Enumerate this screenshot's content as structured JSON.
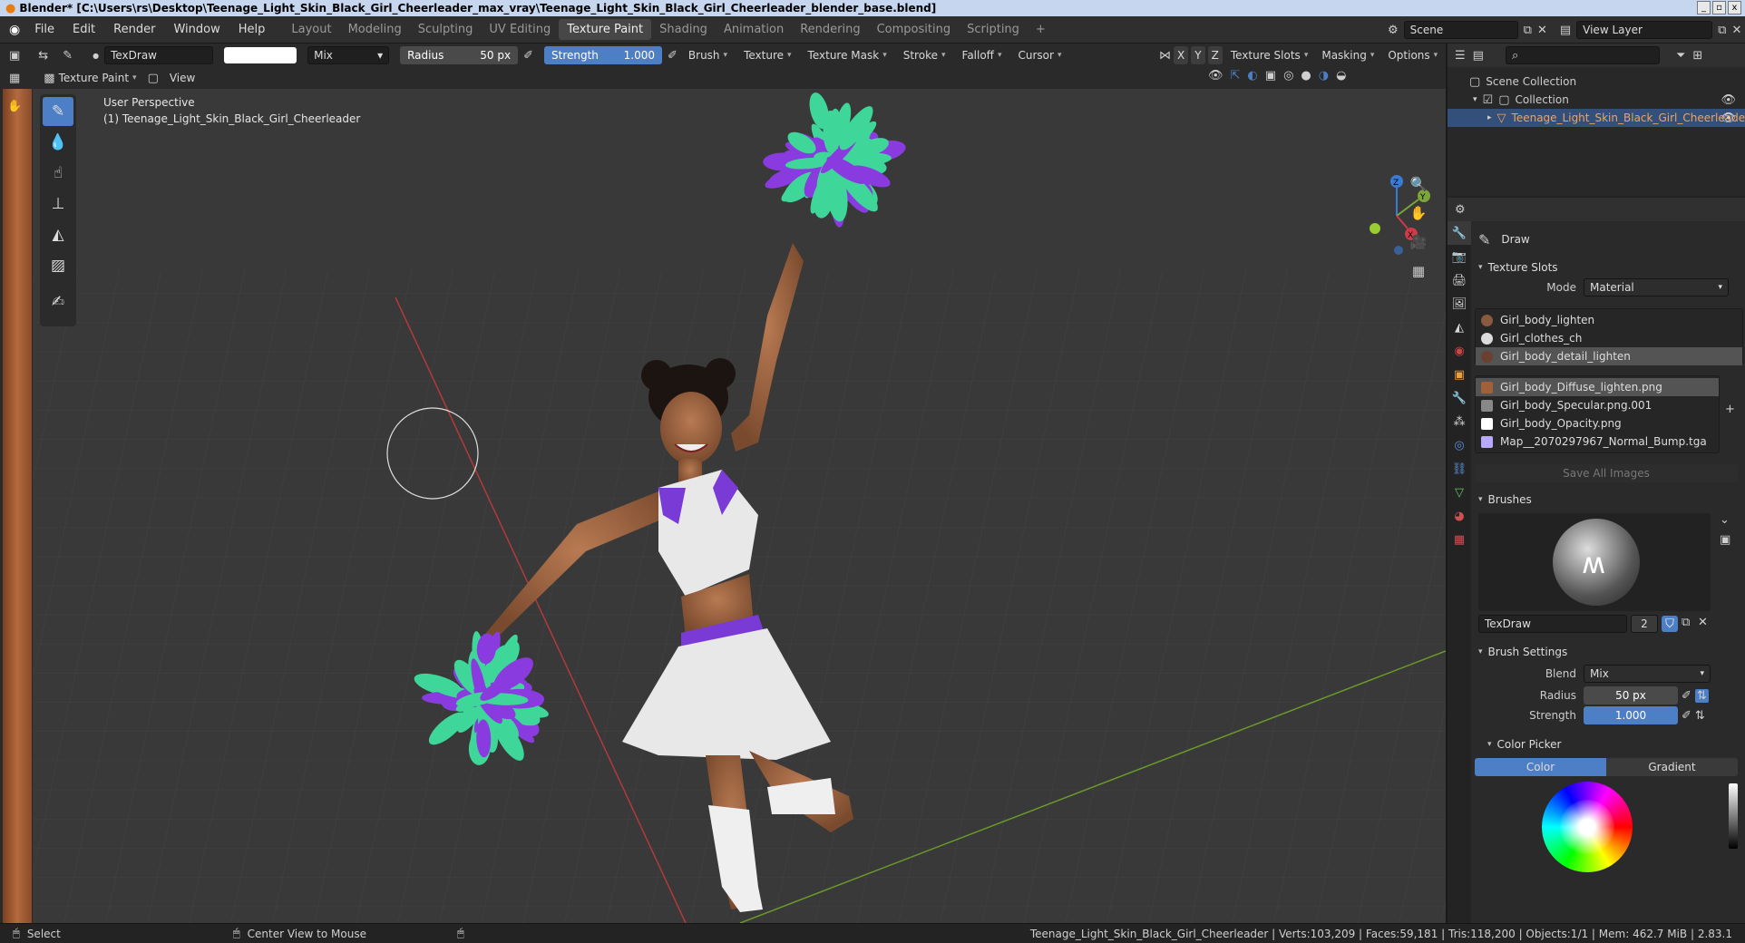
{
  "title_bar": {
    "text": "Blender* [C:\\Users\\rs\\Desktop\\Teenage_Light_Skin_Black_Girl_Cheerleader_max_vray\\Teenage_Light_Skin_Black_Girl_Cheerleader_blender_base.blend]",
    "min": "_",
    "max": "▫",
    "close": "x"
  },
  "menu": {
    "items": [
      "File",
      "Edit",
      "Render",
      "Window",
      "Help"
    ]
  },
  "workspaces": {
    "tabs": [
      "Layout",
      "Modeling",
      "Sculpting",
      "UV Editing",
      "Texture Paint",
      "Shading",
      "Animation",
      "Rendering",
      "Compositing",
      "Scripting"
    ],
    "active": "Texture Paint",
    "add": "+"
  },
  "scene": {
    "name": "Scene",
    "view_layer": "View Layer"
  },
  "tool_header": {
    "brush_name": "TexDraw",
    "blend": "Mix",
    "radius_label": "Radius",
    "radius_value": "50 px",
    "strength_label": "Strength",
    "strength_value": "1.000",
    "menus": [
      "Brush",
      "Texture",
      "Texture Mask",
      "Stroke",
      "Falloff",
      "Cursor"
    ],
    "axes": [
      "X",
      "Y",
      "Z"
    ],
    "right_menus": [
      "Texture Slots",
      "Masking",
      "Options"
    ]
  },
  "mode_header": {
    "mode": "Texture Paint",
    "view": "View"
  },
  "viewport": {
    "perspective": "User Perspective",
    "object": "(1) Teenage_Light_Skin_Black_Girl_Cheerleader",
    "gizmo": {
      "x": "X",
      "y": "Y",
      "z": "Z"
    }
  },
  "outliner": {
    "root": "Scene Collection",
    "collection": "Collection",
    "object": "Teenage_Light_Skin_Black_Girl_Cheerleader"
  },
  "properties": {
    "tool_name": "Draw",
    "texture_slots_header": "Texture Slots",
    "mode_label": "Mode",
    "mode_value": "Material",
    "materials": [
      "Girl_body_lighten",
      "Girl_clothes_ch",
      "Girl_body_detail_lighten"
    ],
    "selected_material": 2,
    "images": [
      "Girl_body_Diffuse_lighten.png",
      "Girl_body_Specular.png.001",
      "Girl_body_Opacity.png",
      "Map__2070297967_Normal_Bump.tga"
    ],
    "selected_image": 0,
    "save_all": "Save All Images",
    "brushes_header": "Brushes",
    "brush_name": "TexDraw",
    "brush_users": "2",
    "brush_settings_header": "Brush Settings",
    "blend_label": "Blend",
    "blend_value": "Mix",
    "radius_label": "Radius",
    "radius_value": "50 px",
    "strength_label": "Strength",
    "strength_value": "1.000",
    "color_picker_header": "Color Picker",
    "color_tab": "Color",
    "gradient_tab": "Gradient"
  },
  "status_bar": {
    "select": "Select",
    "center": "Center View to Mouse",
    "stats": "Teenage_Light_Skin_Black_Girl_Cheerleader | Verts:103,209 | Faces:59,181 | Tris:118,200 | Objects:1/1 | Mem: 462.7 MiB | 2.83.1"
  },
  "colors": {
    "accent": "#4d7fc6",
    "viewport_bg": "#393939",
    "x_axis": "#b33a3a",
    "y_axis": "#6a9a2a",
    "pompom_purple": "#8a3be0",
    "pompom_green": "#3fd69a"
  }
}
